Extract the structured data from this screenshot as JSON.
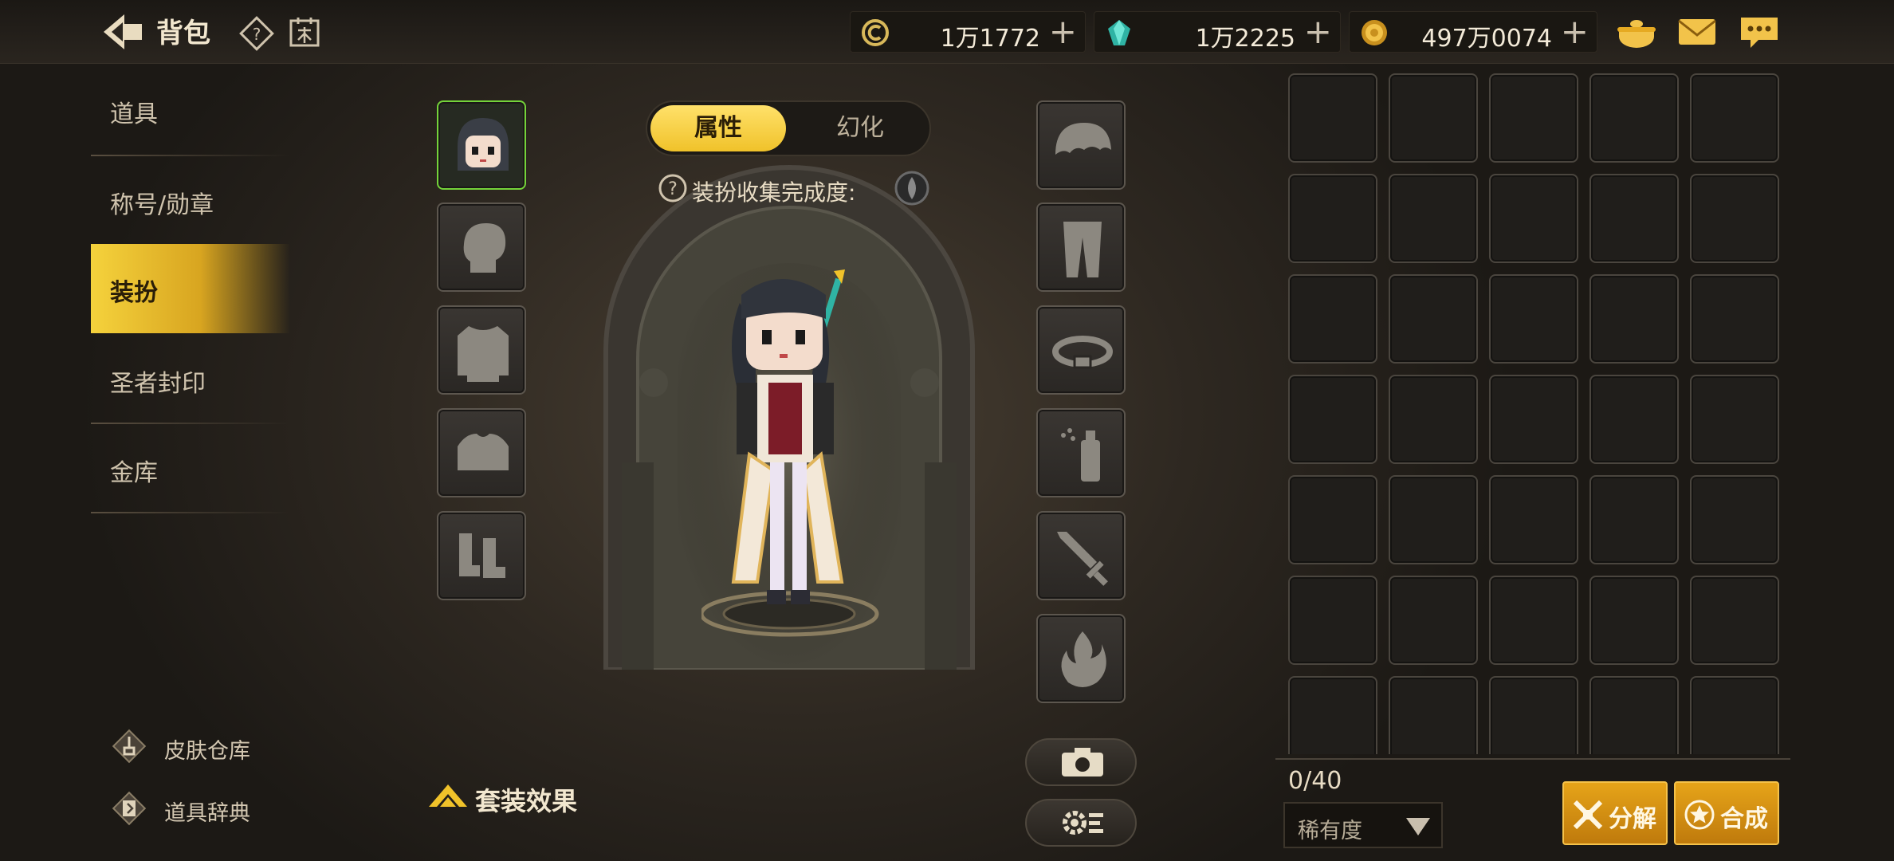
{
  "header": {
    "title": "背包",
    "currencies": [
      {
        "icon": "coin-c-icon",
        "value": "1万1772"
      },
      {
        "icon": "gem-icon",
        "value": "1万2225"
      },
      {
        "icon": "gold-coin-icon",
        "value": "497万0074"
      }
    ],
    "icons": [
      "back-arrow-icon",
      "help-icon",
      "calendar-icon",
      "pot-icon",
      "mail-icon",
      "chat-icon"
    ]
  },
  "sidebar": {
    "items": [
      {
        "label": "道具"
      },
      {
        "label": "称号/勋章"
      },
      {
        "label": "装扮",
        "active": true
      },
      {
        "label": "圣者封印"
      },
      {
        "label": "金库"
      }
    ],
    "bottom_links": [
      {
        "label": "皮肤仓库"
      },
      {
        "label": "道具辞典"
      }
    ]
  },
  "main": {
    "tabs": [
      {
        "label": "属性",
        "active": true
      },
      {
        "label": "幻化"
      }
    ],
    "collection_label": "装扮收集完成度:",
    "set_effect_label": "套装效果",
    "left_slots": [
      "portrait",
      "head",
      "top",
      "shoulder",
      "shoes"
    ],
    "right_slots": [
      "hair",
      "pants",
      "belt",
      "spray",
      "weapon",
      "aura"
    ]
  },
  "inventory": {
    "count": "0/40",
    "rarity_label": "稀有度",
    "decompose_label": "分解",
    "synthesize_label": "合成"
  },
  "colors": {
    "accent": "#f0c22a",
    "button": "#d48f14",
    "selected_slot": "#74d33a"
  }
}
